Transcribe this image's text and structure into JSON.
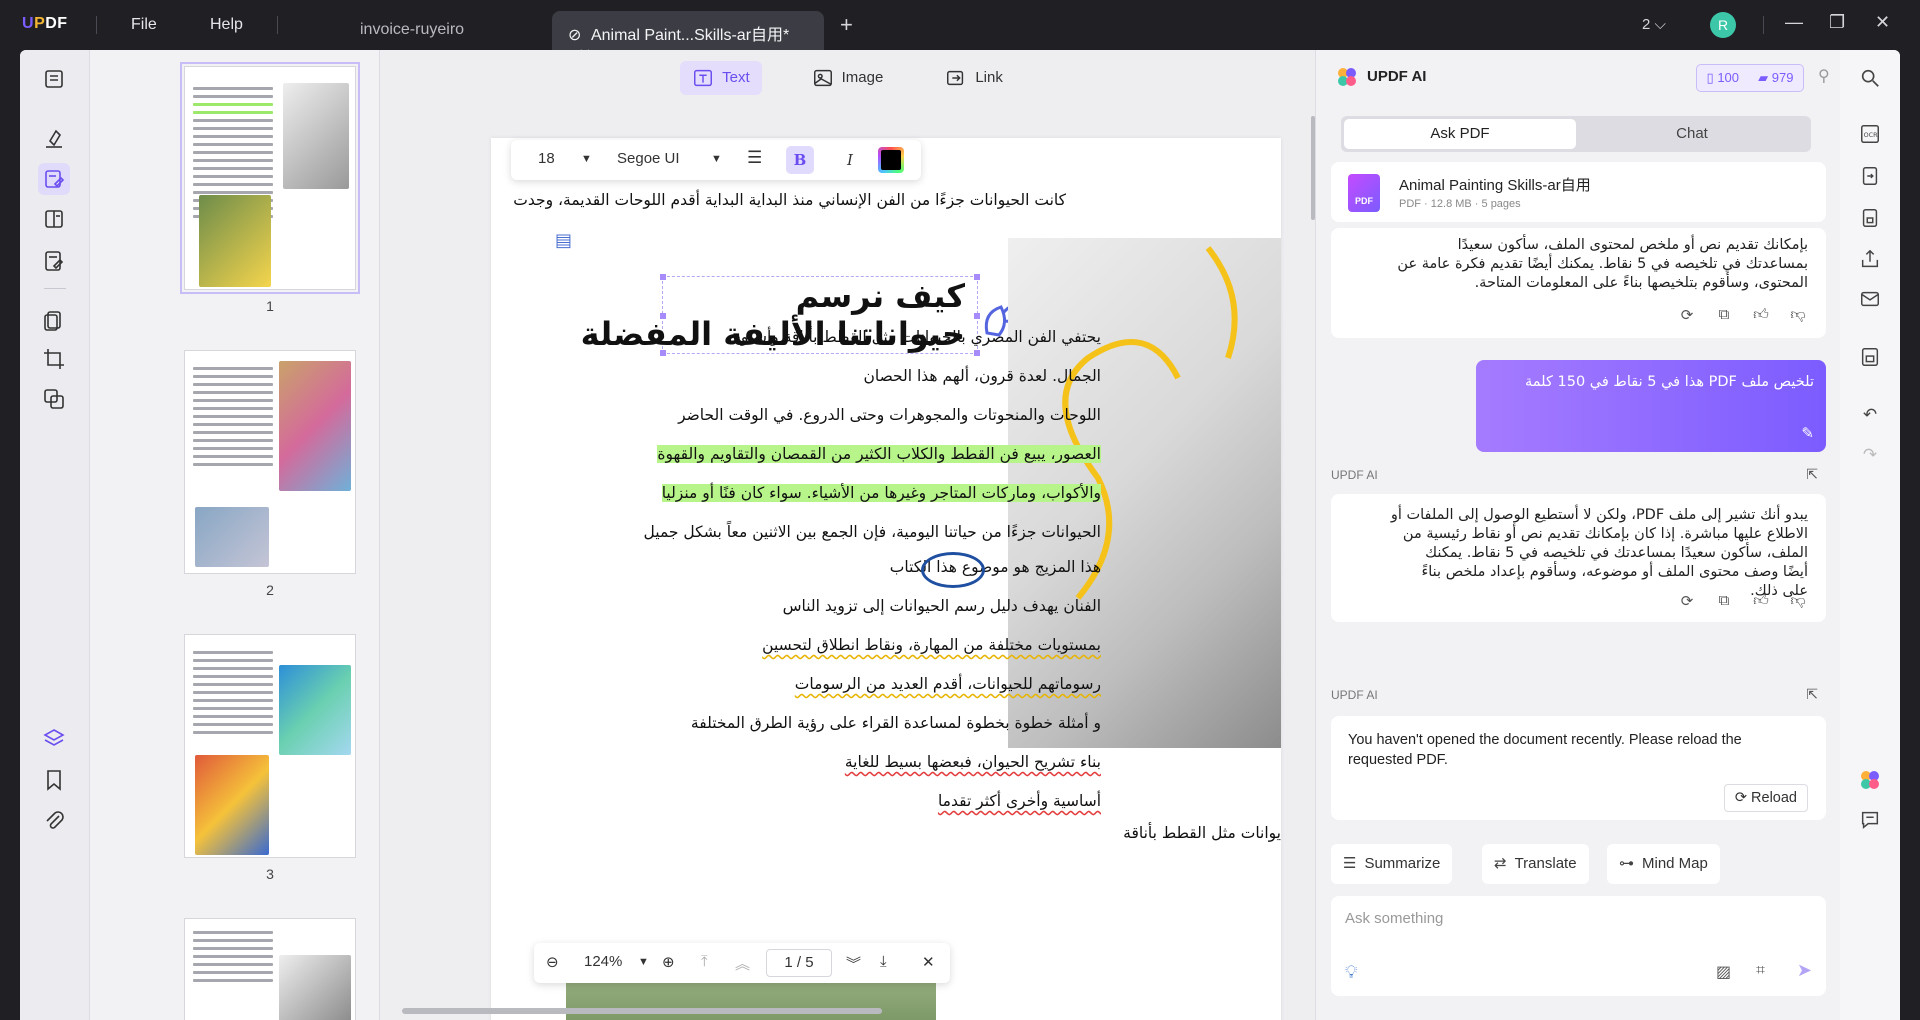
{
  "app": {
    "logo": "UPDF",
    "menu": [
      "File",
      "Help"
    ],
    "tabs": [
      {
        "label": "invoice-ruyeiro",
        "active": false
      },
      {
        "label": "Animal Paint...Skills-ar自用*",
        "active": true
      }
    ],
    "page_count_indicator": "2",
    "avatar_initial": "R"
  },
  "edit_toolbar": {
    "text_label": "Text",
    "image_label": "Image",
    "link_label": "Link"
  },
  "format_bar": {
    "font_size": "18",
    "font_name": "Segoe UI",
    "bold": "B",
    "italic": "I"
  },
  "document": {
    "first_line": "كانت الحيوانات جزءًا من الفن الإنساني منذ البداية البداية أقدم اللوحات القديمة، وجدت",
    "title_line1": "كيف نرسم",
    "title_line2": "حيواناتنا الأليفة المفضلة",
    "lines": [
      {
        "text": "يحتفي الفن المصري بالحيوانات مثل القطط بأناقة وأسلوب",
        "style": "plain"
      },
      {
        "text": "الجمال. لعدة قرون، ألهم هذا الحصان",
        "style": "plain"
      },
      {
        "text": "اللوحات والمنحوتات والمجوهرات وحتى الدروع. في الوقت الحاضر",
        "style": "plain"
      },
      {
        "text": "العصور، يبيع فن القطط والكلاب الكثير من القمصان والتقاويم والقهوة",
        "style": "highlight"
      },
      {
        "text": "والأكواب، وماركات المتاجر وغيرها من الأشياء. سواء كان فنًا أو منزليا",
        "style": "highlight"
      },
      {
        "text": "الحيوانات جزءًا من حياتنا اليومية، فإن الجمع بين الاثنين معاً بشكل جميل",
        "style": "plain"
      },
      {
        "text": "هذا المزيج هو موضوع هذا الكتاب",
        "style": "plain"
      },
      {
        "text": "الفنان يهدف دليل رسم الحيوانات إلى تزويد الناس",
        "style": "plain"
      },
      {
        "text": "بمستويات مختلفة من المهارة، ونقاط انطلاق لتحسين",
        "style": "wavy"
      },
      {
        "text": "رسوماتهم للحيوانات، أقدم العديد من الرسومات",
        "style": "wavy"
      },
      {
        "text": "و أمثلة خطوة بخطوة لمساعدة القراء على رؤية الطرق المختلفة",
        "style": "plain"
      },
      {
        "text": "بناء تشريح الحيوان، فبعضها بسيط للغاية",
        "style": "wavyred"
      },
      {
        "text": "أساسية وأخرى أكثر تقدما",
        "style": "wavyred"
      }
    ],
    "side_caption": "يوانات مثل القطط بأناقة"
  },
  "thumbnails": [
    {
      "label": "1"
    },
    {
      "label": "2"
    },
    {
      "label": "3"
    }
  ],
  "zoom_bar": {
    "zoom": "124%",
    "page": "1 / 5"
  },
  "ai": {
    "title": "UPDF AI",
    "credits_a": "100",
    "credits_b": "979",
    "tab_ask": "Ask PDF",
    "tab_chat": "Chat",
    "file_name": "Animal Painting Skills-ar自用",
    "file_meta": "PDF · 12.8 MB · 5 pages",
    "file_icon_text": "PDF",
    "msg1_lines": [
      "بإمكانك تقديم نص أو ملخص لمحتوى الملف، سأكون سعيدًا",
      "بمساعدتك في تلخيصه في 5 نقاط. يمكنك أيضًا تقديم فكرة عامة عن",
      "المحتوى، وسأقوم بتلخيصها بناءً على المعلومات المتاحة."
    ],
    "user_msg": "تلخيص ملف PDF هذا في 5 نقاط في 150 كلمة",
    "ai_label": "UPDF AI",
    "msg2_lines": [
      "يبدو أنك تشير إلى ملف PDF، ولكن لا أستطيع الوصول إلى الملفات أو",
      "الاطلاع عليها مباشرة. إذا كان بإمكانك تقديم نص أو نقاط رئيسية من",
      "الملف، سأكون سعيدًا بمساعدتك في تلخيصه في 5 نقاط. يمكنك",
      "أيضًا وصف محتوى الملف أو موضوعه، وسأقوم بإعداد ملخص بناءً",
      "على ذلك."
    ],
    "msg3": "You haven't opened the document recently. Please reload the requested PDF.",
    "reload_label": "Reload",
    "summarize_label": "Summarize",
    "translate_label": "Translate",
    "mindmap_label": "Mind Map",
    "ask_placeholder": "Ask something"
  },
  "colors": {
    "accent": "#7b5cff",
    "highlight": "#b7f58a",
    "user_bubble_start": "#a57bff",
    "user_bubble_end": "#7c5cff",
    "titlebar": "#1f1f24"
  }
}
